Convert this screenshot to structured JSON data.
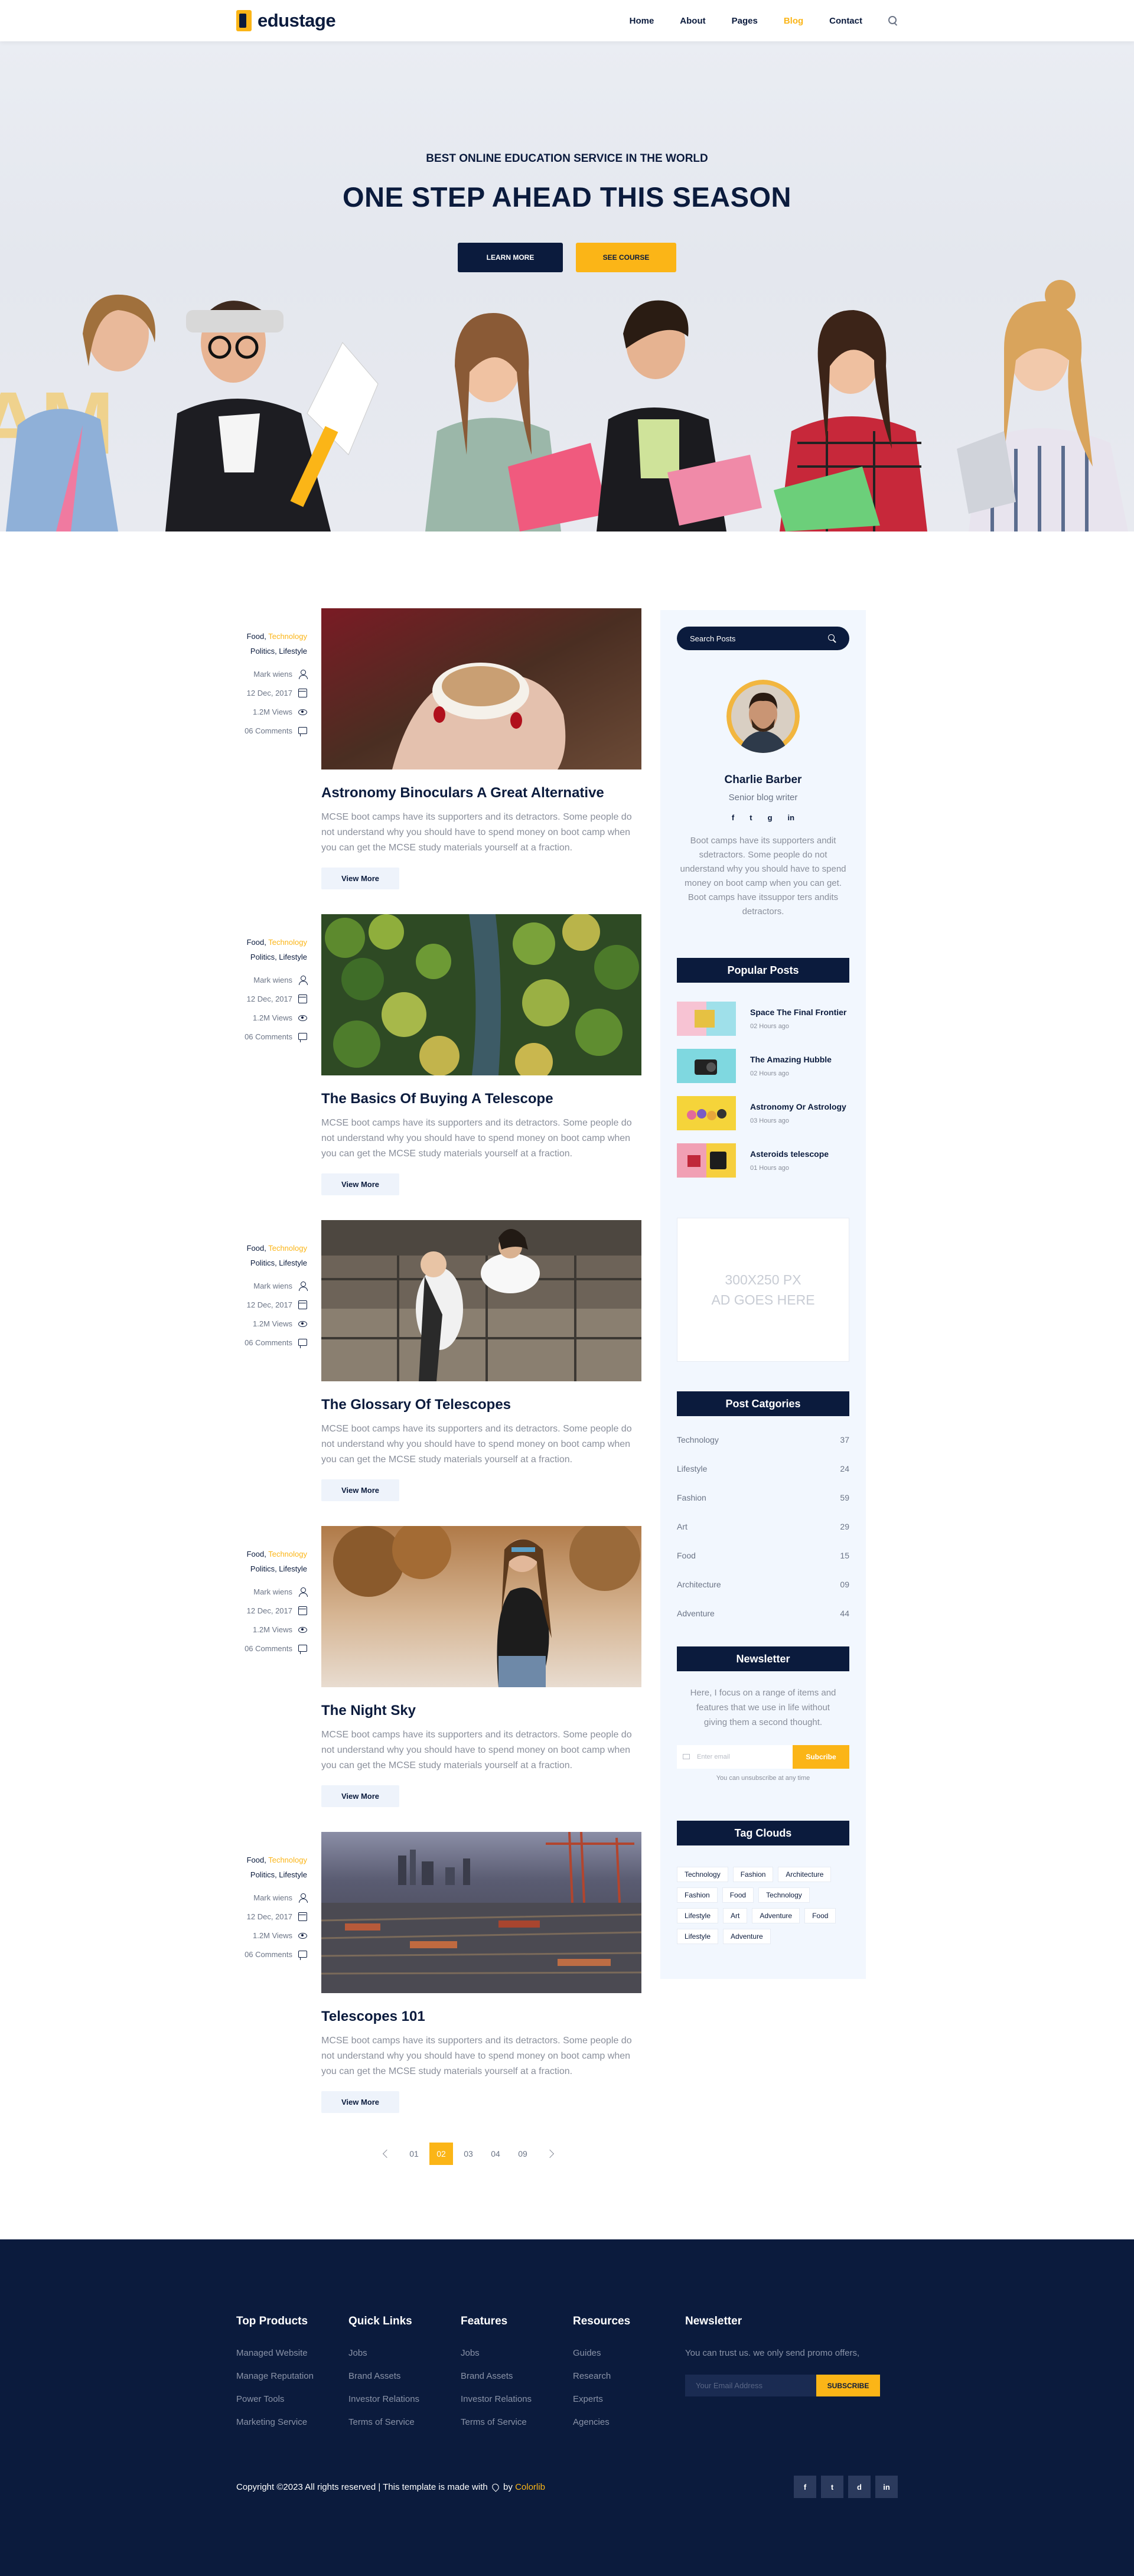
{
  "header": {
    "logo_text": "edustage",
    "nav": [
      "Home",
      "About",
      "Pages",
      "Blog",
      "Contact"
    ],
    "active_nav": "Blog"
  },
  "hero": {
    "eyebrow": "BEST ONLINE EDUCATION SERVICE IN THE WORLD",
    "title": "ONE STEP AHEAD THIS SEASON",
    "learn_more": "LEARN MORE",
    "see_course": "SEE COURSE"
  },
  "posts": [
    {
      "cat_a": "Food, ",
      "cat_b": "Technology",
      "cat_c": "Politics, Lifestyle",
      "author": "Mark wiens",
      "date": "12 Dec, 2017",
      "views": "1.2M Views",
      "comments": "06 Comments",
      "title": "Astronomy Binoculars A Great Alternative",
      "excerpt": "MCSE boot camps have its supporters and its detractors. Some people do not understand why you should have to spend money on boot camp when you can get the MCSE study materials yourself at a fraction.",
      "cta": "View More"
    },
    {
      "cat_a": "Food, ",
      "cat_b": "Technology",
      "cat_c": "Politics, Lifestyle",
      "author": "Mark wiens",
      "date": "12 Dec, 2017",
      "views": "1.2M Views",
      "comments": "06 Comments",
      "title": "The Basics Of Buying A Telescope",
      "excerpt": "MCSE boot camps have its supporters and its detractors. Some people do not understand why you should have to spend money on boot camp when you can get the MCSE study materials yourself at a fraction.",
      "cta": "View More"
    },
    {
      "cat_a": "Food, ",
      "cat_b": "Technology",
      "cat_c": "Politics, Lifestyle",
      "author": "Mark wiens",
      "date": "12 Dec, 2017",
      "views": "1.2M Views",
      "comments": "06 Comments",
      "title": "The Glossary Of Telescopes",
      "excerpt": "MCSE boot camps have its supporters and its detractors. Some people do not understand why you should have to spend money on boot camp when you can get the MCSE study materials yourself at a fraction.",
      "cta": "View More"
    },
    {
      "cat_a": "Food, ",
      "cat_b": "Technology",
      "cat_c": "Politics, Lifestyle",
      "author": "Mark wiens",
      "date": "12 Dec, 2017",
      "views": "1.2M Views",
      "comments": "06 Comments",
      "title": "The Night Sky",
      "excerpt": "MCSE boot camps have its supporters and its detractors. Some people do not understand why you should have to spend money on boot camp when you can get the MCSE study materials yourself at a fraction.",
      "cta": "View More"
    },
    {
      "cat_a": "Food, ",
      "cat_b": "Technology",
      "cat_c": "Politics, Lifestyle",
      "author": "Mark wiens",
      "date": "12 Dec, 2017",
      "views": "1.2M Views",
      "comments": "06 Comments",
      "title": "Telescopes 101",
      "excerpt": "MCSE boot camps have its supporters and its detractors. Some people do not understand why you should have to spend money on boot camp when you can get the MCSE study materials yourself at a fraction.",
      "cta": "View More"
    }
  ],
  "pagination": {
    "pages": [
      "01",
      "02",
      "03",
      "04",
      "09"
    ],
    "current": "02"
  },
  "sidebar": {
    "search_placeholder": "Search Posts",
    "author": {
      "name": "Charlie Barber",
      "role": "Senior blog writer",
      "socials": [
        "f",
        "t",
        "g",
        "in"
      ],
      "bio": "Boot camps have its supporters andit sdetractors. Some people do not understand why you should have to spend money on boot camp when you can get. Boot camps have itssuppor ters andits detractors."
    },
    "popular_title": "Popular Posts",
    "popular": [
      {
        "title": "Space The Final Frontier",
        "time": "02 Hours ago"
      },
      {
        "title": "The Amazing Hubble",
        "time": "02 Hours ago"
      },
      {
        "title": "Astronomy Or Astrology",
        "time": "03 Hours ago"
      },
      {
        "title": "Asteroids telescope",
        "time": "01 Hours ago"
      }
    ],
    "ad_line1": "300X250 PX",
    "ad_line2": "AD GOES HERE",
    "categories_title": "Post Catgories",
    "categories": [
      {
        "name": "Technology",
        "count": "37"
      },
      {
        "name": "Lifestyle",
        "count": "24"
      },
      {
        "name": "Fashion",
        "count": "59"
      },
      {
        "name": "Art",
        "count": "29"
      },
      {
        "name": "Food",
        "count": "15"
      },
      {
        "name": "Architecture",
        "count": "09"
      },
      {
        "name": "Adventure",
        "count": "44"
      }
    ],
    "newsletter_title": "Newsletter",
    "newsletter_text": "Here, I focus on a range of items and features that we use in life without giving them a second thought.",
    "newsletter_placeholder": "Enter email",
    "newsletter_button": "Subcribe",
    "newsletter_note": "You can unsubscribe at any time",
    "tags_title": "Tag Clouds",
    "tags": [
      "Technology",
      "Fashion",
      "Architecture",
      "Fashion",
      "Food",
      "Technology",
      "Lifestyle",
      "Art",
      "Adventure",
      "Food",
      "Lifestyle",
      "Adventure"
    ]
  },
  "footer": {
    "columns": [
      {
        "title": "Top Products",
        "items": [
          "Managed Website",
          "Manage Reputation",
          "Power Tools",
          "Marketing Service"
        ]
      },
      {
        "title": "Quick Links",
        "items": [
          "Jobs",
          "Brand Assets",
          "Investor Relations",
          "Terms of Service"
        ]
      },
      {
        "title": "Features",
        "items": [
          "Jobs",
          "Brand Assets",
          "Investor Relations",
          "Terms of Service"
        ]
      },
      {
        "title": "Resources",
        "items": [
          "Guides",
          "Research",
          "Experts",
          "Agencies"
        ]
      }
    ],
    "newsletter_title": "Newsletter",
    "newsletter_text": "You can trust us. we only send promo offers,",
    "newsletter_placeholder": "Your Email Address",
    "newsletter_button": "SUBSCRIBE",
    "copyright_a": "Copyright ©2023 All rights reserved | This template is made with",
    "copyright_b": "by",
    "copyright_brand": "Colorlib",
    "socials": [
      "f",
      "t",
      "d",
      "in"
    ]
  },
  "colors": {
    "navy": "#0b1b3d",
    "accent": "#fbb517",
    "sidebar_bg": "#f2f7fe"
  }
}
